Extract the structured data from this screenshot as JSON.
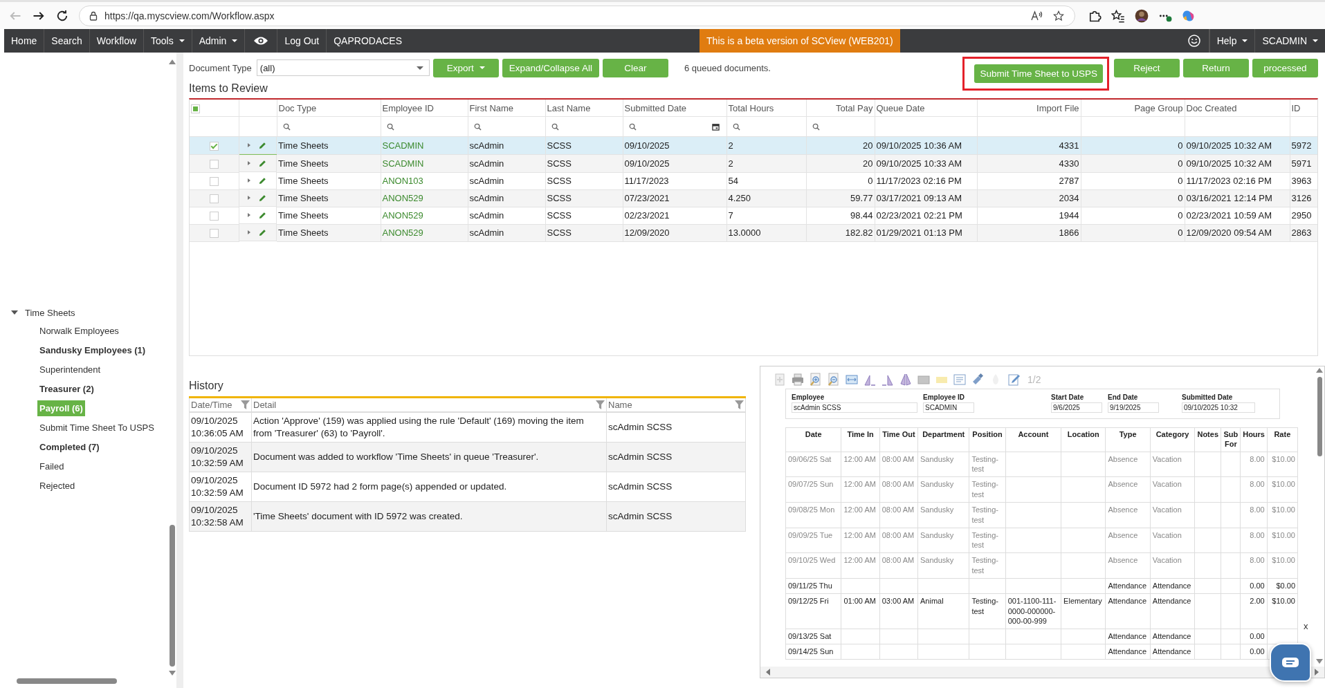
{
  "browser": {
    "url": "https://qa.myscview.com/Workflow.aspx"
  },
  "nav": {
    "items": [
      {
        "label": "Home",
        "kind": "link"
      },
      {
        "label": "Search",
        "kind": "link"
      },
      {
        "label": "Workflow",
        "kind": "link"
      },
      {
        "label": "Tools",
        "kind": "menu"
      },
      {
        "label": "Admin",
        "kind": "menu"
      },
      {
        "kind": "eye"
      },
      {
        "label": "Log Out",
        "kind": "link"
      },
      {
        "label": "QAPRODACES",
        "kind": "text"
      }
    ],
    "banner": "This is a beta version of SCView (WEB201)",
    "right": [
      {
        "kind": "smile"
      },
      {
        "label": "Help",
        "kind": "menu"
      },
      {
        "label": "SCADMIN",
        "kind": "menu"
      }
    ]
  },
  "sidebar": {
    "tree": [
      {
        "label": "Time Sheets",
        "expanded": true,
        "children": [
          {
            "label": "Norwalk Employees",
            "has_items": false,
            "selected": false
          },
          {
            "label": "Sandusky Employees (1)",
            "has_items": true,
            "selected": false
          },
          {
            "label": "Superintendent",
            "has_items": false,
            "selected": false
          },
          {
            "label": "Treasurer (2)",
            "has_items": true,
            "selected": false
          },
          {
            "label": "Payroll (6)",
            "has_items": true,
            "selected": true
          },
          {
            "label": "Submit Time Sheet To USPS",
            "has_items": false,
            "selected": false
          },
          {
            "label": "Completed (7)",
            "has_items": true,
            "selected": false
          },
          {
            "label": "Failed",
            "has_items": false,
            "selected": false
          },
          {
            "label": "Rejected",
            "has_items": false,
            "selected": false
          }
        ]
      }
    ]
  },
  "toolbar": {
    "doc_type_label": "Document Type",
    "doc_type_value": "(all)",
    "buttons": [
      {
        "label": "Export",
        "menu": true
      },
      {
        "label": "Expand/Collapse All",
        "menu": false
      },
      {
        "label": "Clear",
        "menu": false
      }
    ],
    "queued": "6 queued documents.",
    "actions": [
      {
        "label": "Submit Time Sheet to USPS",
        "highlighted": true
      },
      {
        "label": "Reject",
        "highlighted": false
      },
      {
        "label": "Return",
        "highlighted": false
      },
      {
        "label": "processed",
        "highlighted": false
      }
    ]
  },
  "table": {
    "title": "Items to Review",
    "select_all": {
      "checked": false,
      "partial": true
    },
    "columns": [
      {
        "label": "Doc Type",
        "right_aligned": false,
        "searchable": true,
        "calendar": false,
        "link": false
      },
      {
        "label": "Employee ID",
        "right_aligned": false,
        "searchable": true,
        "calendar": false,
        "link": true
      },
      {
        "label": "First Name",
        "right_aligned": false,
        "searchable": true,
        "calendar": false,
        "link": false
      },
      {
        "label": "Last Name",
        "right_aligned": false,
        "searchable": true,
        "calendar": false,
        "link": false
      },
      {
        "label": "Submitted Date",
        "right_aligned": false,
        "searchable": true,
        "calendar": true,
        "link": false
      },
      {
        "label": "Total Hours",
        "right_aligned": false,
        "searchable": true,
        "calendar": false,
        "link": false
      },
      {
        "label": "Total Pay",
        "right_aligned": true,
        "searchable": true,
        "calendar": false,
        "link": false
      },
      {
        "label": "Queue Date",
        "right_aligned": false,
        "searchable": false,
        "calendar": false,
        "link": false
      },
      {
        "label": "Import File",
        "right_aligned": true,
        "searchable": false,
        "calendar": false,
        "link": false
      },
      {
        "label": "Page Group",
        "right_aligned": true,
        "searchable": false,
        "calendar": false,
        "link": false
      },
      {
        "label": "Doc Created",
        "right_aligned": false,
        "searchable": false,
        "calendar": false,
        "link": false
      },
      {
        "label": "ID",
        "right_aligned": false,
        "searchable": false,
        "calendar": false,
        "link": false
      }
    ],
    "rows": [
      {
        "checked": true,
        "selected": true,
        "cells": [
          "Time Sheets",
          "SCADMIN",
          "scAdmin",
          "SCSS",
          "09/10/2025",
          "2",
          "20",
          "09/10/2025 10:36 AM",
          "4331",
          "0",
          "09/10/2025 10:32 AM",
          "5972"
        ]
      },
      {
        "checked": false,
        "selected": false,
        "cells": [
          "Time Sheets",
          "SCADMIN",
          "scAdmin",
          "SCSS",
          "09/10/2025",
          "2",
          "20",
          "09/10/2025 10:33 AM",
          "4330",
          "0",
          "09/10/2025 10:32 AM",
          "5971"
        ]
      },
      {
        "checked": false,
        "selected": false,
        "cells": [
          "Time Sheets",
          "ANON103",
          "scAdmin",
          "SCSS",
          "11/17/2023",
          "54",
          "0",
          "11/17/2023 02:16 PM",
          "2787",
          "0",
          "11/17/2023 02:16 PM",
          "3963"
        ]
      },
      {
        "checked": false,
        "selected": false,
        "cells": [
          "Time Sheets",
          "ANON529",
          "scAdmin",
          "SCSS",
          "07/23/2021",
          "4.250",
          "59.77",
          "03/17/2021 09:13 AM",
          "2034",
          "0",
          "03/16/2021 12:14 PM",
          "3126"
        ]
      },
      {
        "checked": false,
        "selected": false,
        "cells": [
          "Time Sheets",
          "ANON529",
          "scAdmin",
          "SCSS",
          "02/23/2021",
          "7",
          "98.44",
          "02/23/2021 02:21 PM",
          "1944",
          "0",
          "02/23/2021 10:59 AM",
          "2950"
        ]
      },
      {
        "checked": false,
        "selected": false,
        "cells": [
          "Time Sheets",
          "ANON529",
          "scAdmin",
          "SCSS",
          "12/09/2020",
          "13.0000",
          "182.82",
          "01/29/2021 01:13 PM",
          "1866",
          "0",
          "12/09/2020 09:54 AM",
          "2863"
        ]
      }
    ]
  },
  "history": {
    "title": "History",
    "columns": [
      "Date/Time",
      "Detail",
      "Name"
    ],
    "rows": [
      {
        "datetime": "09/10/2025 10:36:05 AM",
        "detail": "Action 'Approve' (159) was applied using the rule 'Default' (169) moving the item from 'Treasurer' (63) to 'Payroll'.",
        "name": "scAdmin SCSS"
      },
      {
        "datetime": "09/10/2025 10:32:59 AM",
        "detail": "Document was added to workflow 'Time Sheets' in queue 'Treasurer'.",
        "name": "scAdmin SCSS"
      },
      {
        "datetime": "09/10/2025 10:32:59 AM",
        "detail": "Document ID 5972 had 2 form page(s) appended or updated.",
        "name": "scAdmin SCSS"
      },
      {
        "datetime": "09/10/2025 10:32:58 AM",
        "detail": "'Time Sheets' document with ID 5972 was created.",
        "name": "scAdmin SCSS"
      }
    ]
  },
  "viewer": {
    "page": "1/2",
    "form": [
      {
        "label": "Employee",
        "value": "scAdmin SCSS"
      },
      {
        "label": "Employee ID",
        "value": "SCADMIN"
      },
      {
        "label": "Start Date",
        "value": "9/6/2025"
      },
      {
        "label": "End Date",
        "value": "9/19/2025"
      },
      {
        "label": "Submitted Date",
        "value": "09/10/2025 10:32"
      }
    ],
    "columns": [
      "Date",
      "Time In",
      "Time Out",
      "Department",
      "Position",
      "Account",
      "Location",
      "Type",
      "Category",
      "Notes",
      "Sub For",
      "Hours",
      "Rate"
    ],
    "rows": [
      {
        "muted": true,
        "cells": [
          "09/06/25 Sat",
          "12:00 AM",
          "08:00 AM",
          "Sandusky",
          "Testing-test",
          "",
          "",
          "Absence",
          "Vacation",
          "",
          "",
          "8.00",
          "$10.00"
        ]
      },
      {
        "muted": true,
        "cells": [
          "09/07/25 Sun",
          "12:00 AM",
          "08:00 AM",
          "Sandusky",
          "Testing-test",
          "",
          "",
          "Absence",
          "Vacation",
          "",
          "",
          "8.00",
          "$10.00"
        ]
      },
      {
        "muted": true,
        "cells": [
          "09/08/25 Mon",
          "12:00 AM",
          "08:00 AM",
          "Sandusky",
          "Testing-test",
          "",
          "",
          "Absence",
          "Vacation",
          "",
          "",
          "8.00",
          "$10.00"
        ]
      },
      {
        "muted": true,
        "cells": [
          "09/09/25 Tue",
          "12:00 AM",
          "08:00 AM",
          "Sandusky",
          "Testing-test",
          "",
          "",
          "Absence",
          "Vacation",
          "",
          "",
          "8.00",
          "$10.00"
        ]
      },
      {
        "muted": true,
        "cells": [
          "09/10/25 Wed",
          "12:00 AM",
          "08:00 AM",
          "Sandusky",
          "Testing-test",
          "",
          "",
          "Absence",
          "Vacation",
          "",
          "",
          "8.00",
          "$10.00"
        ]
      },
      {
        "muted": false,
        "cells": [
          "09/11/25 Thu",
          "",
          "",
          "",
          "",
          "",
          "",
          "Attendance",
          "Attendance",
          "",
          "",
          "0.00",
          "$0.00"
        ]
      },
      {
        "muted": false,
        "cells": [
          "09/12/25 Fri",
          "01:00 AM",
          "03:00 AM",
          "Animal",
          "Testing-test",
          "001-1100-111-0000-000000-000-00-999",
          "Elementary",
          "Attendance",
          "Attendance",
          "",
          "",
          "2.00",
          "$10.00"
        ]
      },
      {
        "muted": false,
        "cells": [
          "09/13/25 Sat",
          "",
          "",
          "",
          "",
          "",
          "",
          "Attendance",
          "Attendance",
          "",
          "",
          "0.00",
          ""
        ]
      },
      {
        "muted": false,
        "cells": [
          "09/14/25 Sun",
          "",
          "",
          "",
          "",
          "",
          "",
          "Attendance",
          "Attendance",
          "",
          "",
          "0.00",
          ""
        ]
      }
    ]
  },
  "chat": {
    "close": "x"
  }
}
